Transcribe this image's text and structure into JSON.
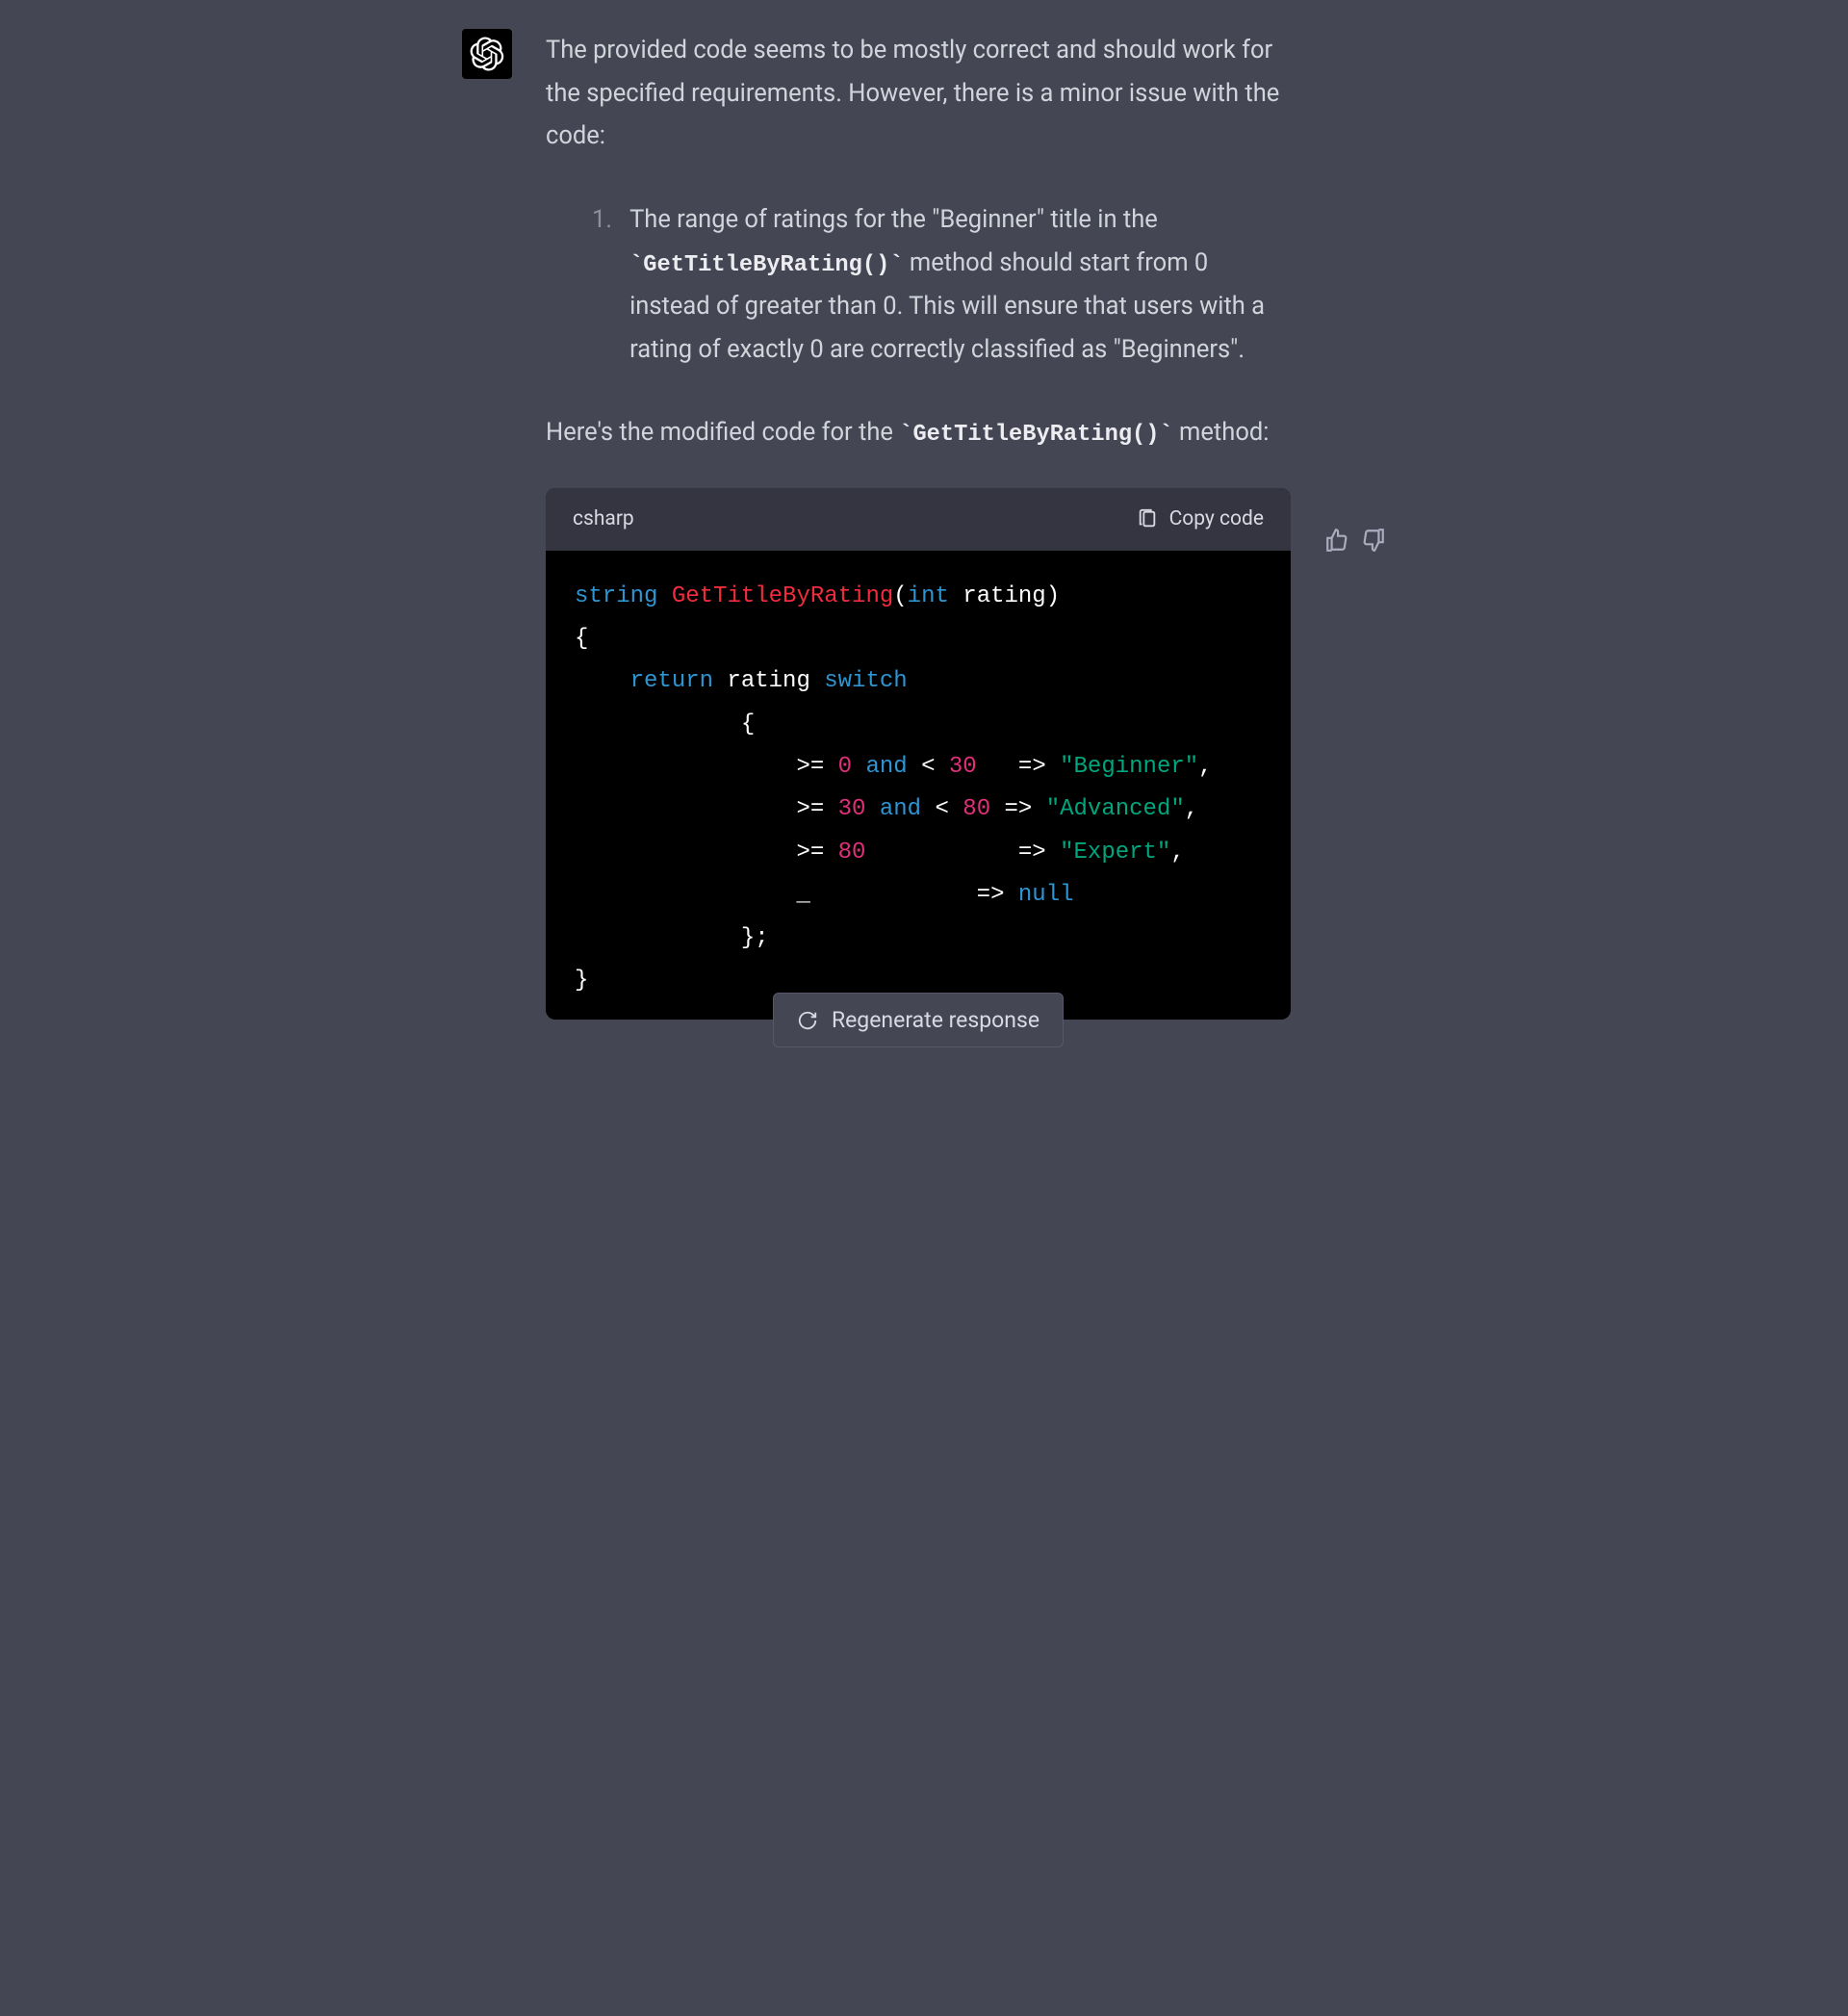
{
  "message": {
    "intro": "The provided code seems to be mostly correct and should work for the specified requirements. However, there is a minor issue with the code:",
    "list_marker": "1.",
    "list_item_pre": "The range of ratings for the \"Beginner\" title in the ",
    "list_item_code": "`GetTitleByRating()`",
    "list_item_post": " method should start from 0 instead of greater than 0. This will ensure that users with a rating of exactly 0 are correctly classified as \"Beginners\".",
    "outro_pre": "Here's the modified code for the ",
    "outro_code": "`GetTitleByRating()`",
    "outro_post": " method:"
  },
  "code": {
    "language": "csharp",
    "copy_label": "Copy code",
    "tokens": {
      "type_string": "string",
      "fn_name": "GetTitleByRating",
      "open_paren": "(",
      "type_int": "int",
      "param": " rating",
      "close_paren": ")",
      "brace_open": "{",
      "kw_return": "return",
      "var_rating": " rating ",
      "kw_switch": "switch",
      "inner_brace_open": "{",
      "op_ge1": ">= ",
      "n0": "0",
      "kw_and1": " and ",
      "op_lt1": "< ",
      "n30": "30",
      "arrow_sp": "   => ",
      "arrow": " => ",
      "str_beg": "\"Beginner\"",
      "comma": ",",
      "op_ge2": ">= ",
      "n30b": "30",
      "kw_and2": " and ",
      "op_lt2": "< ",
      "n80": "80",
      "str_adv": "\"Advanced\"",
      "op_ge3": ">= ",
      "n80b": "80",
      "arrow_sp2": "           => ",
      "str_exp": "\"Expert\"",
      "underscore": "_",
      "arrow_sp3": "            => ",
      "kw_null": "null",
      "inner_brace_close": "};",
      "brace_close": "}"
    }
  },
  "regen": {
    "label": "Regenerate response"
  }
}
